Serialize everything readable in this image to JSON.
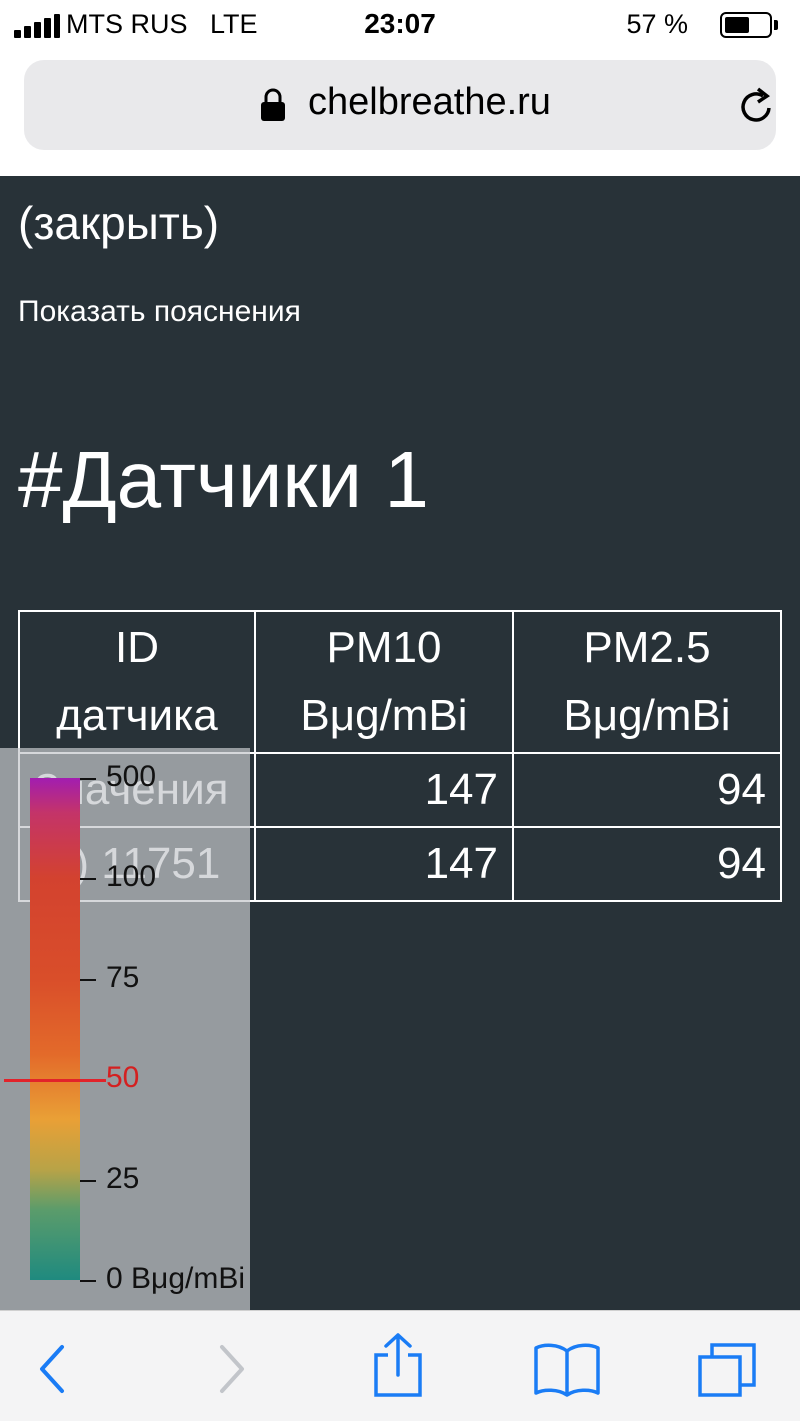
{
  "status_bar": {
    "carrier": "MTS RUS",
    "network": "LTE",
    "time": "23:07",
    "battery_percent_text": "57 %",
    "battery_level": 0.57
  },
  "browser": {
    "url": "chelbreathe.ru",
    "icons": [
      "lock-icon",
      "reload-icon"
    ]
  },
  "page": {
    "close_link": "(закрыть)",
    "explain_link": "Показать пояснения",
    "title": "#Датчики 1"
  },
  "table": {
    "headers": [
      {
        "line1": "ID",
        "line2": "датчика"
      },
      {
        "line1": "PM10",
        "line2": "Bμg/mBi"
      },
      {
        "line1": "PM2.5",
        "line2": "Bμg/mBi"
      }
    ],
    "rows": [
      {
        "id": "Значения",
        "pm10": "147",
        "pm25": "94"
      },
      {
        "id": "(+) 11751",
        "pm10": "147",
        "pm25": "94"
      }
    ]
  },
  "legend": {
    "ticks": [
      {
        "label": "500",
        "value": 500
      },
      {
        "label": "100",
        "value": 100
      },
      {
        "label": "75",
        "value": 75
      },
      {
        "label": "50",
        "value": 50,
        "limit": true
      },
      {
        "label": "25",
        "value": 25
      },
      {
        "label": "0 Bμg/mBi",
        "value": 0
      }
    ],
    "limit_color": "#e2232a",
    "gradient_colors": [
      "#a21db0",
      "#d3422f",
      "#e36a2a",
      "#e9a036",
      "#1f8a7f"
    ]
  },
  "toolbar": {
    "icons": [
      "back-icon",
      "forward-icon",
      "share-icon",
      "bookmarks-icon",
      "tabs-icon"
    ],
    "accent": "#1a7cf5"
  }
}
